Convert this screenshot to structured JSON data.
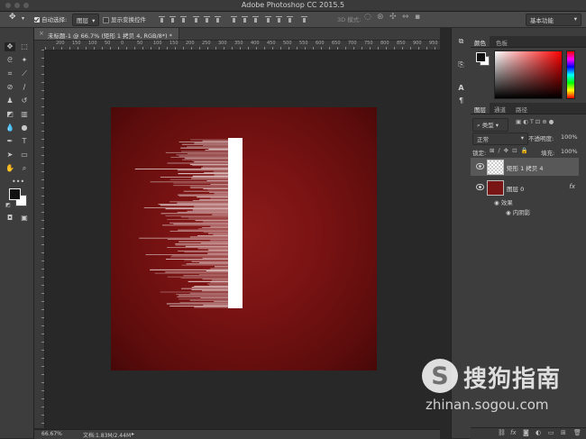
{
  "window": {
    "title": "Adobe Photoshop CC 2015.5"
  },
  "options_bar": {
    "auto_select_label": "自动选择:",
    "auto_select_value": "图层",
    "show_transform_label": "显示变换控件",
    "mode3d_label": "3D 模式:",
    "workspace_value": "基本功能"
  },
  "document": {
    "tab_label": "未标题-1 @ 66.7% (矩形 1 拷贝 4, RGB/8*) *",
    "ruler_numbers": [
      "200",
      "150",
      "100",
      "50",
      "0",
      "50",
      "100",
      "150",
      "200",
      "250",
      "300",
      "350",
      "400",
      "450",
      "500",
      "550",
      "600",
      "650",
      "700",
      "750",
      "800",
      "850",
      "900",
      "950",
      "1000",
      "1050",
      "1100",
      "1150",
      "1200",
      "1250",
      "1300",
      "1350",
      "1400"
    ]
  },
  "status": {
    "zoom": "66.67%",
    "doc_info": "文档:1.83M/2.44M"
  },
  "colors": {
    "canvas_red": "#7a1313",
    "ui_dark": "#3d3d3d"
  },
  "color_panel": {
    "tab_color": "颜色",
    "tab_swatches": "色板"
  },
  "layers_panel": {
    "tab_layers": "图层",
    "tab_channels": "通道",
    "tab_paths": "路径",
    "filter_kind": "类型",
    "blend_mode": "正常",
    "opacity_label": "不透明度:",
    "opacity_value": "100%",
    "lock_label": "锁定:",
    "fill_label": "填充:",
    "fill_value": "100%",
    "layers": [
      {
        "name": "矩形 1 拷贝 4",
        "selected": true
      },
      {
        "name": "图层 0",
        "fx": "fx",
        "effects_label": "效果",
        "effect": "内阴影"
      }
    ]
  },
  "watermark": {
    "brand": "搜狗指南",
    "url": "zhinan.sogou.com",
    "logo_letter": "S"
  }
}
